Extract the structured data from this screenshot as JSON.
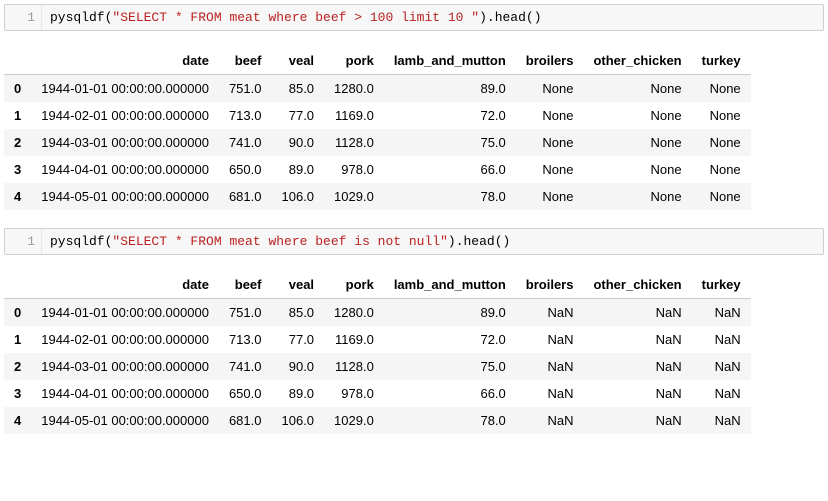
{
  "cells": [
    {
      "lineno": "1",
      "fn": "pysqldf",
      "open": "(",
      "str": "\"SELECT * FROM meat where beef > 100 limit 10 \"",
      "close": ")",
      "tail": ".head()"
    },
    {
      "lineno": "1",
      "fn": "pysqldf",
      "open": "(",
      "str": "\"SELECT * FROM meat where beef is not null\"",
      "close": ")",
      "tail": ".head()"
    }
  ],
  "columns": [
    "date",
    "beef",
    "veal",
    "pork",
    "lamb_and_mutton",
    "broilers",
    "other_chicken",
    "turkey"
  ],
  "tables": [
    {
      "null_label": "None",
      "rows": [
        {
          "idx": "0",
          "date": "1944-01-01 00:00:00.000000",
          "beef": "751.0",
          "veal": "85.0",
          "pork": "1280.0",
          "lamb_and_mutton": "89.0"
        },
        {
          "idx": "1",
          "date": "1944-02-01 00:00:00.000000",
          "beef": "713.0",
          "veal": "77.0",
          "pork": "1169.0",
          "lamb_and_mutton": "72.0"
        },
        {
          "idx": "2",
          "date": "1944-03-01 00:00:00.000000",
          "beef": "741.0",
          "veal": "90.0",
          "pork": "1128.0",
          "lamb_and_mutton": "75.0"
        },
        {
          "idx": "3",
          "date": "1944-04-01 00:00:00.000000",
          "beef": "650.0",
          "veal": "89.0",
          "pork": "978.0",
          "lamb_and_mutton": "66.0"
        },
        {
          "idx": "4",
          "date": "1944-05-01 00:00:00.000000",
          "beef": "681.0",
          "veal": "106.0",
          "pork": "1029.0",
          "lamb_and_mutton": "78.0"
        }
      ]
    },
    {
      "null_label": "NaN",
      "rows": [
        {
          "idx": "0",
          "date": "1944-01-01 00:00:00.000000",
          "beef": "751.0",
          "veal": "85.0",
          "pork": "1280.0",
          "lamb_and_mutton": "89.0"
        },
        {
          "idx": "1",
          "date": "1944-02-01 00:00:00.000000",
          "beef": "713.0",
          "veal": "77.0",
          "pork": "1169.0",
          "lamb_and_mutton": "72.0"
        },
        {
          "idx": "2",
          "date": "1944-03-01 00:00:00.000000",
          "beef": "741.0",
          "veal": "90.0",
          "pork": "1128.0",
          "lamb_and_mutton": "75.0"
        },
        {
          "idx": "3",
          "date": "1944-04-01 00:00:00.000000",
          "beef": "650.0",
          "veal": "89.0",
          "pork": "978.0",
          "lamb_and_mutton": "66.0"
        },
        {
          "idx": "4",
          "date": "1944-05-01 00:00:00.000000",
          "beef": "681.0",
          "veal": "106.0",
          "pork": "1029.0",
          "lamb_and_mutton": "78.0"
        }
      ]
    }
  ]
}
